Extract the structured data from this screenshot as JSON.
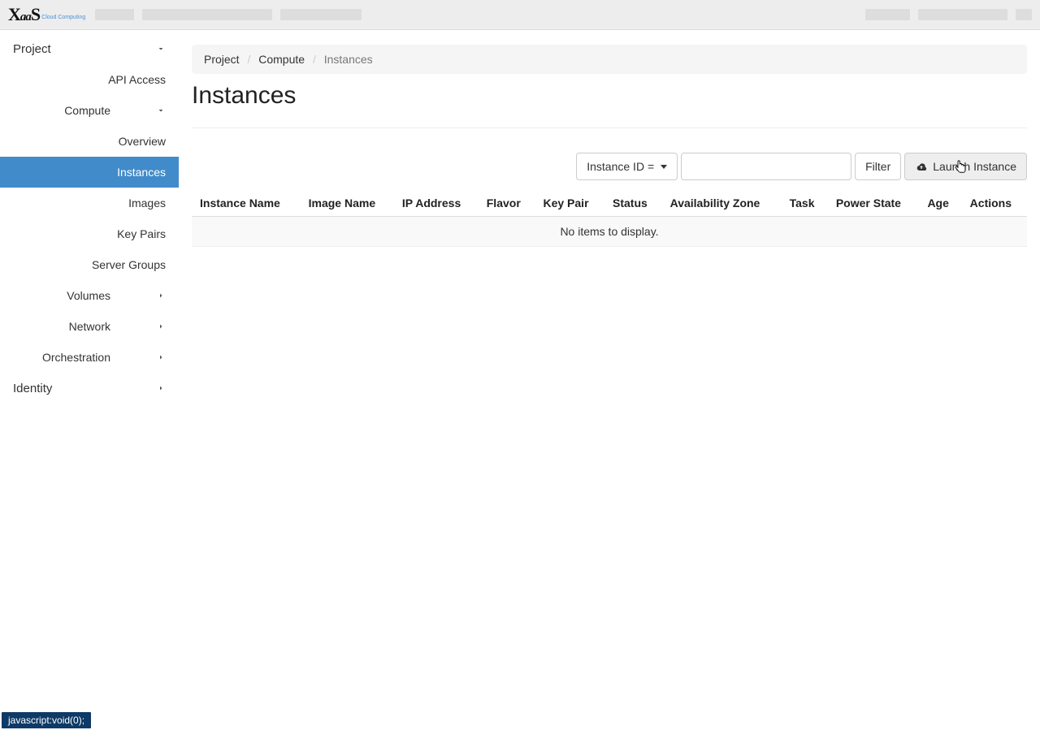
{
  "brand": {
    "main": "XaaS",
    "sub": "Cloud Computing"
  },
  "sidebar": {
    "project": "Project",
    "api_access": "API Access",
    "compute": "Compute",
    "compute_items": {
      "overview": "Overview",
      "instances": "Instances",
      "images": "Images",
      "key_pairs": "Key Pairs",
      "server_groups": "Server Groups"
    },
    "volumes": "Volumes",
    "network": "Network",
    "orchestration": "Orchestration",
    "identity": "Identity"
  },
  "breadcrumb": {
    "project": "Project",
    "compute": "Compute",
    "instances": "Instances"
  },
  "page": {
    "title": "Instances"
  },
  "toolbar": {
    "filter_key": "Instance ID =",
    "search_placeholder": "",
    "filter_btn": "Filter",
    "launch_btn": "Launch Instance"
  },
  "table": {
    "columns": {
      "instance_name": "Instance Name",
      "image_name": "Image Name",
      "ip_address": "IP Address",
      "flavor": "Flavor",
      "key_pair": "Key Pair",
      "status": "Status",
      "availability_zone": "Availability Zone",
      "task": "Task",
      "power_state": "Power State",
      "age": "Age",
      "actions": "Actions"
    },
    "empty": "No items to display."
  },
  "status_bar": "javascript:void(0);"
}
